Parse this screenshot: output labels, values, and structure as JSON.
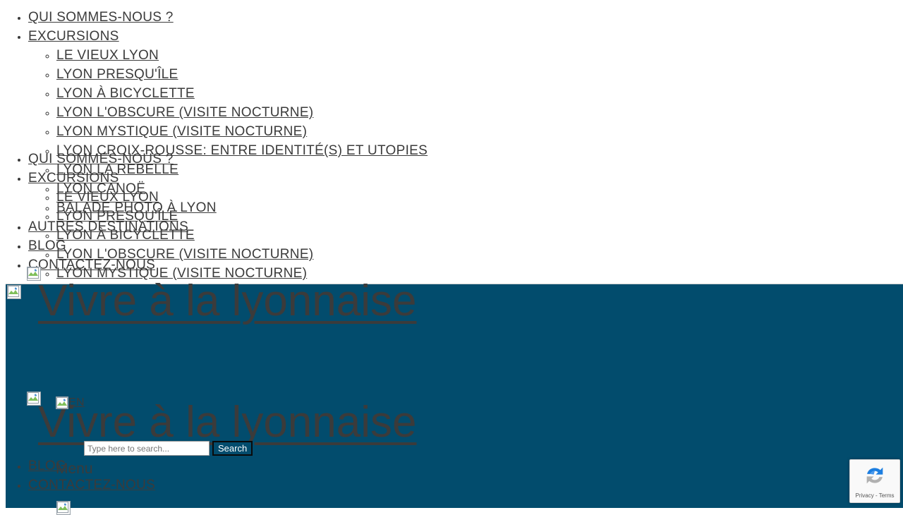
{
  "site": {
    "title": "Vivre à la lyonnaise",
    "banner_color": "#024c6d",
    "text_color": "#3b3b3b"
  },
  "nav": {
    "primary": [
      {
        "label": "QUI SOMMES-NOUS ?",
        "children": []
      },
      {
        "label": "EXCURSIONS",
        "children": [
          {
            "label": "LE VIEUX LYON"
          },
          {
            "label": "LYON PRESQU'ÎLE"
          },
          {
            "label": "LYON À BICYCLETTE"
          },
          {
            "label": "LYON L'OBSCURE (VISITE NOCTURNE)"
          },
          {
            "label": "LYON MYSTIQUE (VISITE NOCTURNE)"
          },
          {
            "label": "LYON CROIX-ROUSSE: ENTRE IDENTITÉ(S) ET UTOPIES"
          },
          {
            "label": "LYON LA REBELLE"
          },
          {
            "label": "LYON CANOË"
          },
          {
            "label": "BALADE PHOTO À LYON"
          }
        ]
      },
      {
        "label": "AUTRES DESTINATIONS",
        "children": []
      },
      {
        "label": "BLOG",
        "children": []
      },
      {
        "label": "CONTACTEZ-NOUS",
        "children": []
      }
    ]
  },
  "language": {
    "current": "EN"
  },
  "search": {
    "placeholder": "Type here to search...",
    "value": "",
    "submit_label": "Search"
  },
  "menu_toggle": {
    "label": "Menu"
  },
  "recaptcha": {
    "privacy_terms": "Privacy - Terms"
  },
  "icons": {
    "broken_image": "broken-image-icon",
    "recaptcha": "recaptcha-icon"
  }
}
